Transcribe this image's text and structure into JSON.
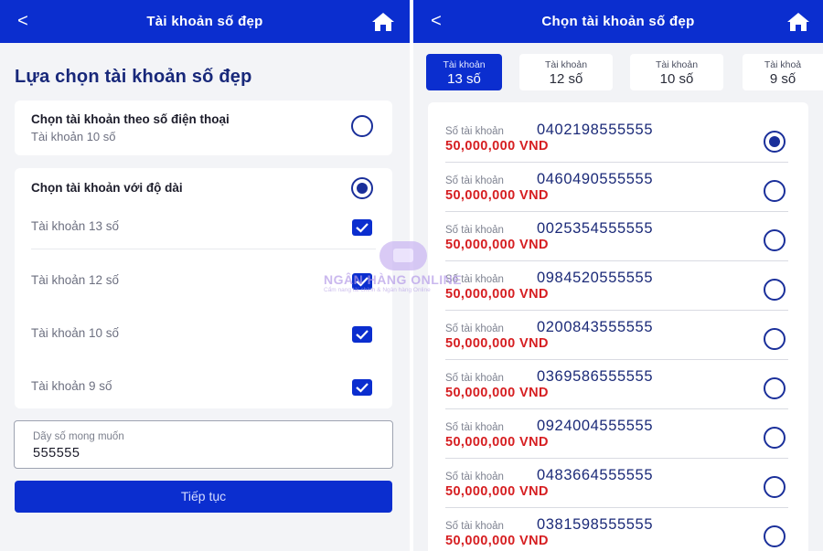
{
  "left": {
    "header_title": "Tài khoản số đẹp",
    "back_glyph": "<",
    "page_heading": "Lựa chọn tài khoản số đẹp",
    "option_phone": {
      "title": "Chọn tài khoản theo số điện thoại",
      "subtitle": "Tài khoản 10 số",
      "selected": false
    },
    "option_length": {
      "title": "Chọn tài khoản với độ dài",
      "selected": true,
      "choices": [
        {
          "label": "Tài khoản 13 số",
          "checked": true
        },
        {
          "label": "Tài khoản 12 số",
          "checked": true
        },
        {
          "label": "Tài khoản 10 số",
          "checked": true
        },
        {
          "label": "Tài khoản 9 số",
          "checked": true
        }
      ]
    },
    "desired_field": {
      "label": "Dãy số mong muốn",
      "value": "555555"
    },
    "continue_button": "Tiếp tục"
  },
  "watermark": {
    "brand": "NGÂN HÀNG ONLINE",
    "tagline": "Cẩm nang tài chính & Ngân hàng Online"
  },
  "right": {
    "header_title": "Chọn tài khoản số đẹp",
    "back_glyph": "<",
    "tabs": [
      {
        "line1": "Tài khoản",
        "line2": "13 số",
        "active": true
      },
      {
        "line1": "Tài khoản",
        "line2": "12 số",
        "active": false
      },
      {
        "line1": "Tài khoản",
        "line2": "10 số",
        "active": false
      },
      {
        "line1": "Tài khoả",
        "line2": "9 số",
        "active": false
      }
    ],
    "account_label": "Số tài khoản",
    "accounts": [
      {
        "number": "0402198555555",
        "price": "50,000,000 VND",
        "selected": true
      },
      {
        "number": "0460490555555",
        "price": "50,000,000 VND",
        "selected": false
      },
      {
        "number": "0025354555555",
        "price": "50,000,000 VND",
        "selected": false
      },
      {
        "number": "0984520555555",
        "price": "50,000,000 VND",
        "selected": false
      },
      {
        "number": "0200843555555",
        "price": "50,000,000 VND",
        "selected": false
      },
      {
        "number": "0369586555555",
        "price": "50,000,000 VND",
        "selected": false
      },
      {
        "number": "0924004555555",
        "price": "50,000,000 VND",
        "selected": false
      },
      {
        "number": "0483664555555",
        "price": "50,000,000 VND",
        "selected": false
      },
      {
        "number": "0381598555555",
        "price": "50,000,000 VND",
        "selected": false
      }
    ]
  },
  "colors": {
    "primary": "#0b2ecf",
    "heading": "#18287a",
    "price": "#d61e21",
    "background": "#f3f4f7"
  },
  "icons": [
    "back-arrow-icon",
    "home-icon",
    "radio-icon",
    "checkbox-icon"
  ]
}
